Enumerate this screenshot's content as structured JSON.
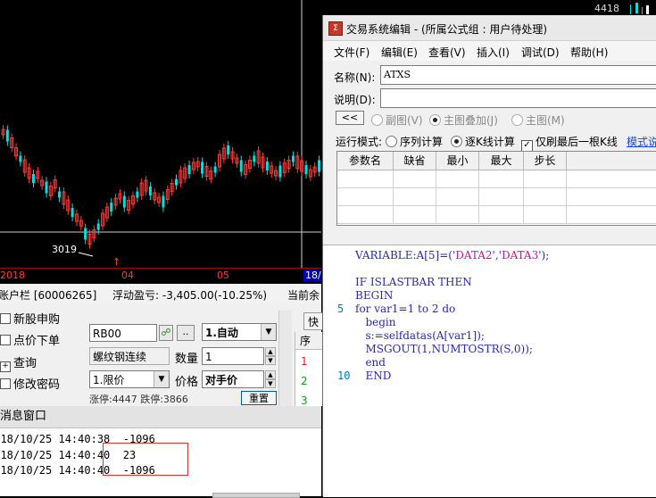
{
  "chart": {
    "price_label": "3019",
    "top_value": "4418",
    "axis_labels": [
      "2018",
      "04",
      "05",
      "18/"
    ]
  },
  "account_bar": {
    "title": "账户栏 [60006265]",
    "pnl": "浮动盈亏: -3,405.00(-10.25%)",
    "current": "当前余"
  },
  "trade": {
    "menu": [
      "新股申购",
      "点价下单",
      "查询",
      "修改密码"
    ],
    "contract_code": "RB00",
    "contract_name": "螺纹钢连续",
    "auto_mode": "1.自动",
    "quantity_label": "数量",
    "quantity": "1",
    "order_type": "1.限价",
    "price_label": "价格",
    "price_value": "对手价",
    "limits": "涨停:4447 跌停:3866",
    "reset_label": "重置",
    "quick_label": "快",
    "seq_header": "序",
    "seq_values": [
      "1",
      "2",
      "3"
    ]
  },
  "message_window": {
    "title": "消息窗口",
    "lines": [
      "2018/10/25 14:40:38  -1096",
      "2018/10/25 14:40:40  23",
      "2018/10/25 14:40:40  -1096"
    ]
  },
  "editor": {
    "title": "交易系统编辑 - (所属公式组 : 用户待处理)",
    "menu": [
      "文件(F)",
      "编辑(E)",
      "查看(V)",
      "插入(I)",
      "调试(D)",
      "帮助(H)"
    ],
    "name_label": "名称(N):",
    "name_value": "ATXS",
    "desc_label": "说明(D):",
    "desc_value": "",
    "back_button": "<<",
    "chart_options": [
      "副图(V)",
      "主图叠加(J)",
      "主图(M)"
    ],
    "run_mode_label": "运行模式:",
    "run_modes": [
      "序列计算",
      "逐K线计算"
    ],
    "last_bar_option": "仅刷最后一根K线",
    "mode_link": "模式说",
    "param_headers": [
      "参数名",
      "缺省",
      "最小",
      "最大",
      "步长"
    ],
    "code_lines": [
      "VARIABLE:A[5]=('DATA2','DATA3');",
      "",
      "IF ISLASTBAR THEN",
      "BEGIN",
      "for var1=1 to 2 do",
      "   begin",
      "   s:=selfdatas(A[var1]);",
      "   MSGOUT(1,NUMTOSTR(S,0));",
      "   end",
      "   END"
    ],
    "line_numbers": [
      "5",
      "10"
    ]
  },
  "colors": {
    "up": "#ff3b3b",
    "down": "#00e0e0",
    "code_keyword": "#2a2aa8",
    "code_string": "#c8148c"
  }
}
